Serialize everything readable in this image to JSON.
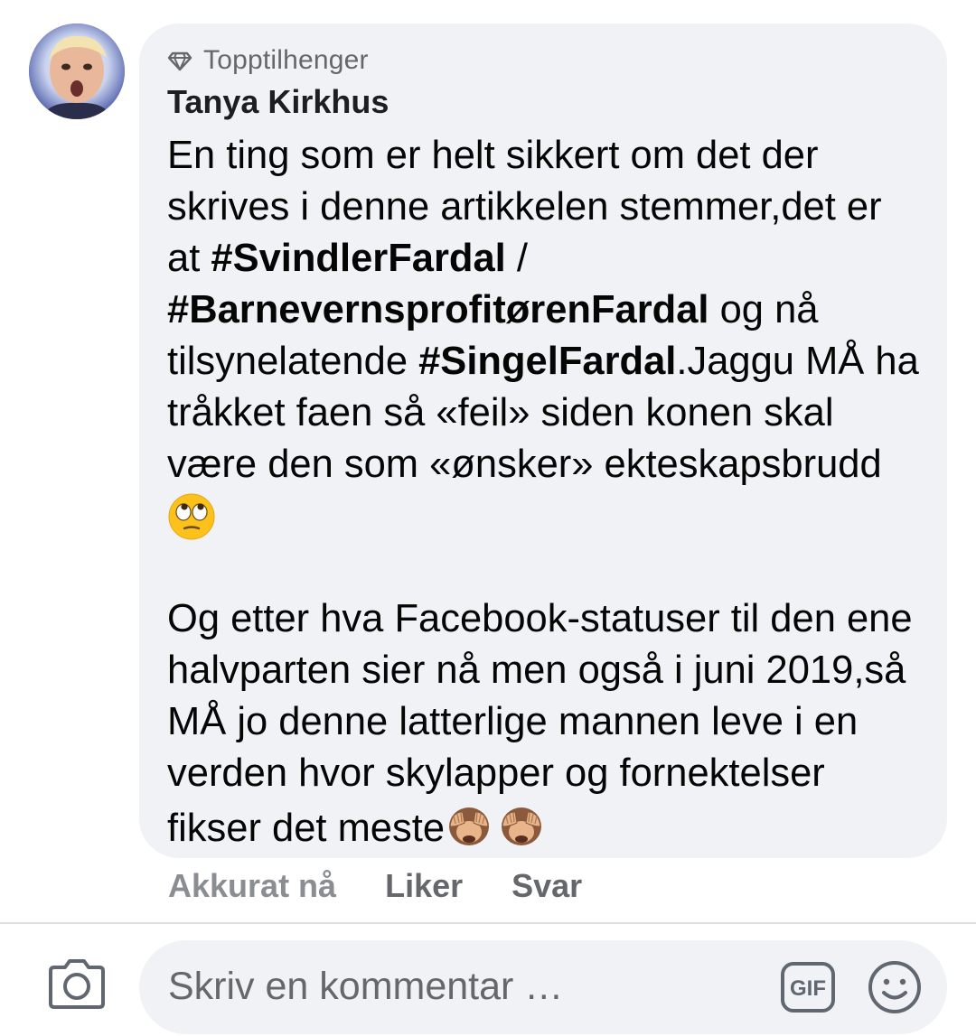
{
  "comment": {
    "badge_icon": "diamond-icon",
    "badge_label": "Topptilhenger",
    "author": "Tanya Kirkhus",
    "paragraph1": {
      "t1": "En ting som er helt sikkert om det der skrives i denne artikkelen stemmer,det er at ",
      "tag1": "#SvindlerFardal",
      "t2": " / ",
      "tag2": "#BarnevernsprofitørenFardal",
      "t3": " og nå tilsynelatende ",
      "tag3": "#SingelFardal",
      "t4": ".Jaggu MÅ ha tråkket faen så «feil» siden konen skal være den som «ønsker» ekteskapsbrudd"
    },
    "paragraph1_emoji": "face-with-rolling-eyes-emoji",
    "paragraph2": {
      "t1": "Og etter hva Facebook-statuser til den ene halvparten sier nå men også i juni 2019,så MÅ jo denne latterlige mannen leve i en verden hvor skylapper og fornektelser fikser det meste"
    },
    "paragraph2_emoji": "see-no-evil-monkey-emoji",
    "actions": {
      "time": "Akkurat nå",
      "like": "Liker",
      "reply": "Svar"
    }
  },
  "composer": {
    "placeholder": "Skriv en kommentar …",
    "camera_icon": "camera-icon",
    "gif_label": "GIF",
    "emoji_icon": "smiley-icon"
  },
  "colors": {
    "bubble_bg": "#f0f2f5",
    "secondary_text": "#65676b",
    "primary_text": "#050505"
  }
}
